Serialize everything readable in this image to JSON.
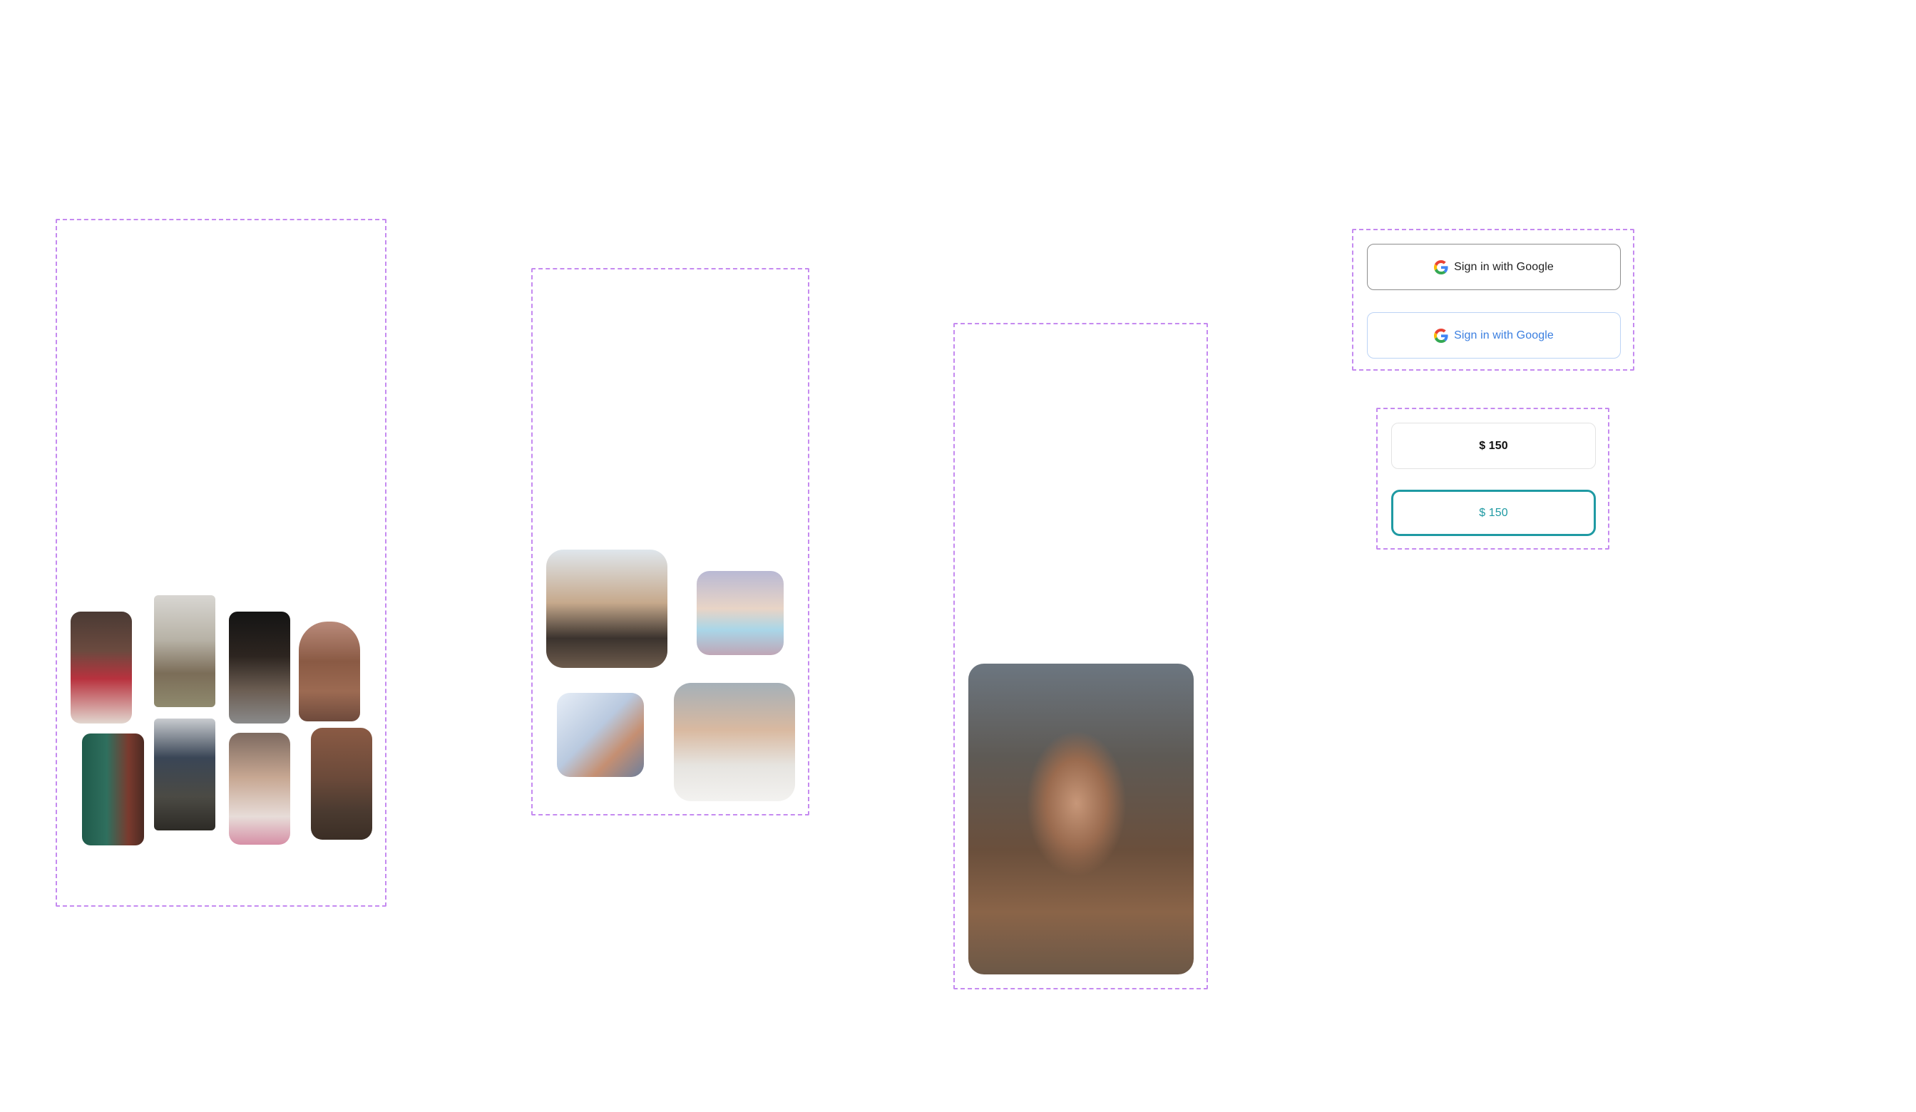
{
  "google_buttons": {
    "primary_label": "Sign in with Google",
    "secondary_label": "Sign in with Google"
  },
  "amount_buttons": {
    "default_label": "$ 150",
    "selected_label": "$ 150"
  },
  "colors": {
    "frame_border": "#c58af0",
    "google_text": "#1f1f1f",
    "google_link_text": "#3b7fe0",
    "accent_teal": "#1f9aa3"
  },
  "icons": {
    "google": "google-g-icon"
  }
}
